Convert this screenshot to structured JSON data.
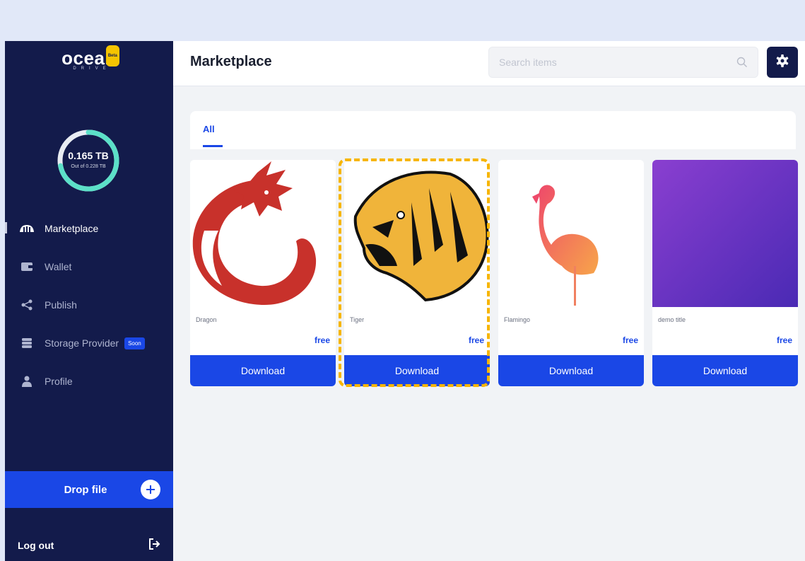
{
  "brand": {
    "name": "ocean",
    "subtitle": "DRIVE",
    "badge": "Beta"
  },
  "storage": {
    "used": "0.165 TB",
    "total": "Out of 0.228 TB",
    "used_fraction": 0.72
  },
  "sidebar": {
    "items": [
      {
        "label": "Marketplace",
        "icon": "marketplace-icon",
        "active": true
      },
      {
        "label": "Wallet",
        "icon": "wallet-icon"
      },
      {
        "label": "Publish",
        "icon": "share-icon"
      },
      {
        "label": "Storage Provider",
        "icon": "database-icon",
        "badge": "Soon"
      },
      {
        "label": "Profile",
        "icon": "user-icon"
      }
    ],
    "drop_file": "Drop file",
    "logout": "Log out"
  },
  "header": {
    "title": "Marketplace",
    "search_placeholder": "Search items"
  },
  "tabs": [
    {
      "label": "All",
      "active": true
    }
  ],
  "items": [
    {
      "title": "Dragon",
      "price": "free",
      "action": "Download"
    },
    {
      "title": "Tiger",
      "price": "free",
      "action": "Download",
      "highlighted": true
    },
    {
      "title": "Flamingo",
      "price": "free",
      "action": "Download"
    },
    {
      "title": "demo title",
      "price": "free",
      "action": "Download"
    }
  ],
  "colors": {
    "sidebar": "#131b4b",
    "accent": "#1a47e6",
    "storage_ring": "#5ce0c8",
    "highlight": "#f7b500"
  }
}
